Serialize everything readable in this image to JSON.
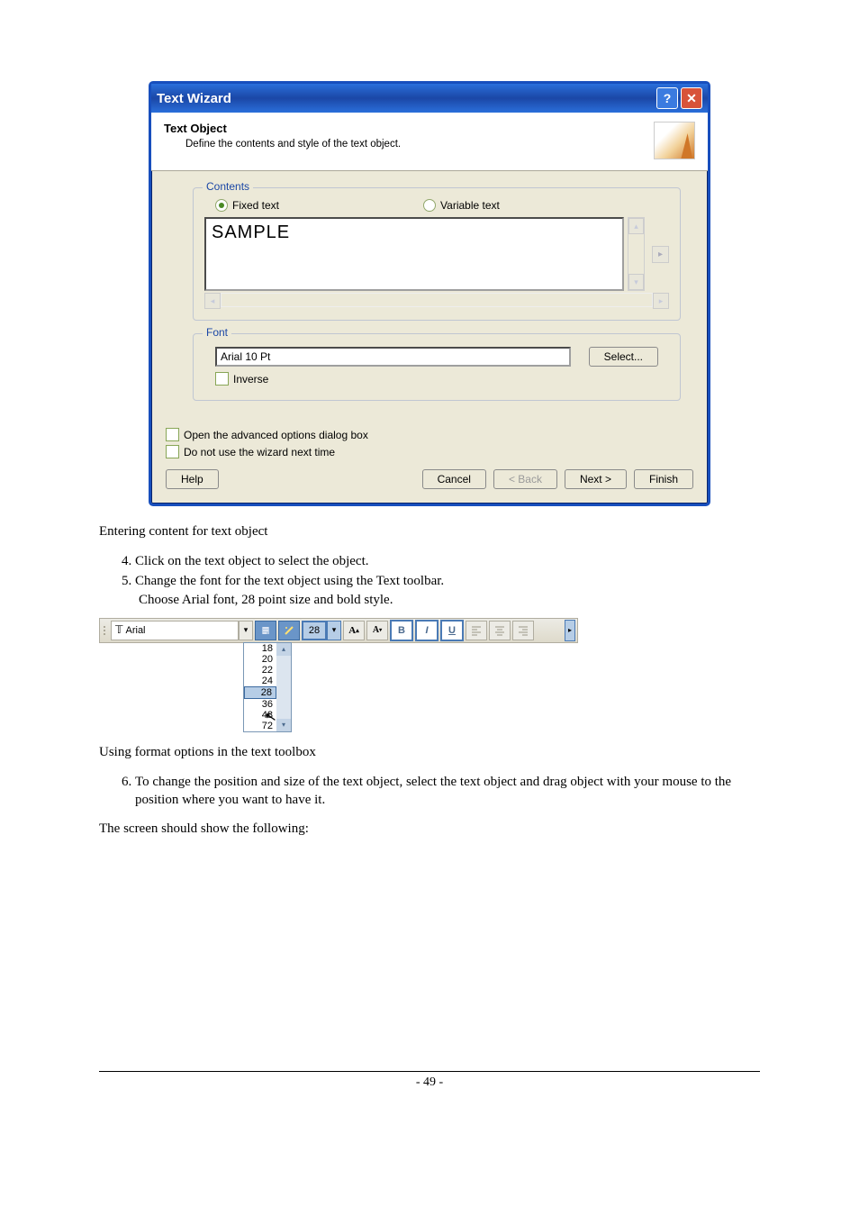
{
  "dialog": {
    "title": "Text Wizard",
    "header_title": "Text Object",
    "header_sub": "Define the contents and style of the text object.",
    "contents": {
      "legend": "Contents",
      "radio_fixed": "Fixed text",
      "radio_variable": "Variable text",
      "sample": "SAMPLE"
    },
    "font": {
      "legend": "Font",
      "value": "Arial 10 Pt",
      "select_btn": "Select...",
      "inverse": "Inverse"
    },
    "footer": {
      "open_adv": "Open the advanced options dialog box",
      "no_wizard": "Do not use the wizard next time",
      "help": "Help",
      "cancel": "Cancel",
      "back": "< Back",
      "next": "Next >",
      "finish": "Finish"
    }
  },
  "caption1": "Entering content for text object",
  "steps1": {
    "s4": "Click on the text object to select the object.",
    "s5": "Change the font for the text object using the Text toolbar.",
    "s5b": "Choose Arial font, 28 point size and bold style."
  },
  "toolbar": {
    "font_name": "Arial",
    "size_value": "28",
    "sizes": [
      "18",
      "20",
      "22",
      "24",
      "28",
      "36",
      "48",
      "72"
    ]
  },
  "caption2": "Using format options in the text toolbox",
  "steps2": {
    "s6": "To change the position and size of the text object, select the text object and drag object with your mouse to the position where you want to have it."
  },
  "after": "The screen should show the following:",
  "page_num": "- 49 -"
}
